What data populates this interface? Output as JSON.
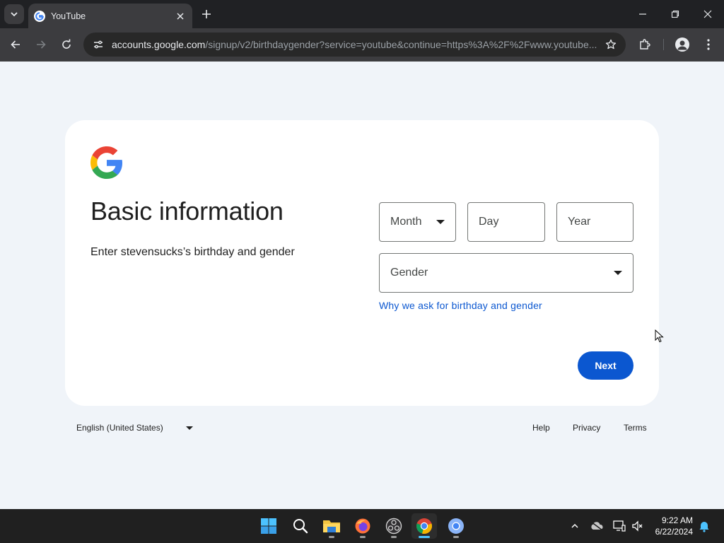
{
  "browser": {
    "tab": {
      "title": "YouTube"
    },
    "address_bar": {
      "host": "accounts.google.com",
      "path": "/signup/v2/birthdaygender?service=youtube&continue=https%3A%2F%2Fwww.youtube..."
    }
  },
  "page": {
    "heading": "Basic information",
    "subheading": "Enter stevensucks’s birthday and gender",
    "fields": {
      "month": {
        "label": "Month"
      },
      "day": {
        "label": "Day"
      },
      "year": {
        "label": "Year"
      },
      "gender": {
        "label": "Gender"
      }
    },
    "why_link": "Why we ask for birthday and gender",
    "next_button": "Next"
  },
  "footer": {
    "language": "English (United States)",
    "links": {
      "help": "Help",
      "privacy": "Privacy",
      "terms": "Terms"
    }
  },
  "taskbar": {
    "apps": [
      "start-icon",
      "search-icon",
      "file-explorer-icon",
      "firefox-icon",
      "obs-icon",
      "chrome-icon",
      "chrome-alt-icon"
    ],
    "clock": {
      "time": "9:22 AM",
      "date": "6/22/2024"
    }
  },
  "colors": {
    "accent": "#0b57d0",
    "page_bg": "#f0f4f9",
    "card_bg": "#ffffff",
    "chrome_dark": "#202124",
    "toolbar": "#3c3c3f"
  }
}
